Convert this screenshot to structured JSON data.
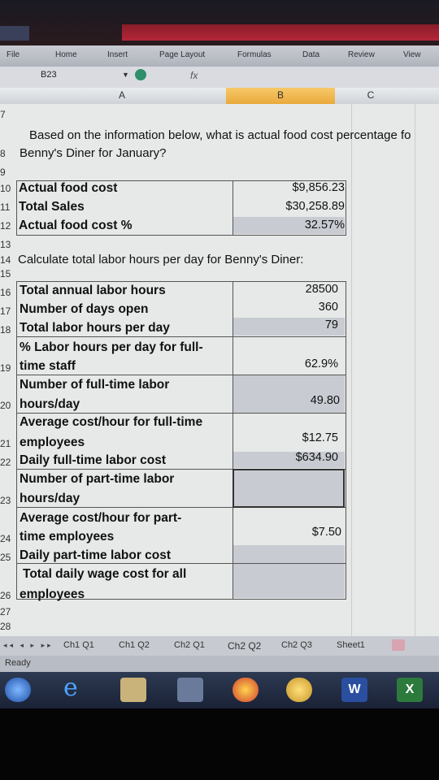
{
  "ribbon": {
    "tabs": [
      "File",
      "Home",
      "Insert",
      "Page Layout",
      "Formulas",
      "Data",
      "Review",
      "View"
    ]
  },
  "formula_bar": {
    "name_box": "B23",
    "fx": "fx",
    "value": ""
  },
  "columns": [
    "A",
    "B",
    "C"
  ],
  "rows": {
    "r7": "7",
    "r8": "8",
    "r9": "9",
    "r10": "10",
    "r11": "11",
    "r12": "12",
    "r13": "13",
    "r14": "14",
    "r15": "15",
    "r16": "16",
    "r17": "17",
    "r18": "18",
    "r19": "19",
    "r20": "20",
    "r21": "21",
    "r22": "22",
    "r23": "23",
    "r24": "24",
    "r25": "25",
    "r26": "26",
    "r27": "27",
    "r28": "28"
  },
  "sheet": {
    "question1_line1": "Based on the information below, what is actual food cost percentage fo",
    "question1_line2": "Benny's Diner for January?",
    "food": [
      {
        "label": "Actual food cost",
        "value": "$9,856.23"
      },
      {
        "label": "Total Sales",
        "value": "$30,258.89"
      },
      {
        "label": "Actual food cost %",
        "value": "32.57%"
      }
    ],
    "question2": "Calculate total labor hours per day for Benny's Diner:",
    "labor": {
      "annual_label": "Total annual labor hours",
      "annual_value": "28500",
      "days_label": "Number of days open",
      "days_value": "360",
      "perday_label": "Total labor hours per day",
      "perday_value": "79",
      "pct_ft_label1": "% Labor hours per day for full-",
      "pct_ft_label2": "time staff",
      "pct_ft_value": "62.9%",
      "ft_hours_label1": "Number of full-time labor",
      "ft_hours_label2": "hours/day",
      "ft_hours_value": "49.80",
      "ft_cost_label1": "Average cost/hour for full-time",
      "ft_cost_label2": "employees",
      "ft_cost_value": "$12.75",
      "daily_ft_label": "Daily full-time labor cost",
      "daily_ft_value": "$634.90",
      "pt_hours_label1": "Number of part-time labor",
      "pt_hours_label2": "hours/day",
      "pt_hours_value": "",
      "pt_cost_label1": "Average cost/hour for part-",
      "pt_cost_label2": "time employees",
      "pt_cost_value": "$7.50",
      "daily_pt_label": "Daily part-time labor cost",
      "daily_pt_value": "",
      "total_label1": "Total daily wage cost for all",
      "total_label2": "employees",
      "total_value": ""
    }
  },
  "sheet_tabs": [
    "Ch1 Q1",
    "Ch1 Q2",
    "Ch2 Q1",
    "Ch2 Q2",
    "Ch2 Q3",
    "Sheet1"
  ],
  "status": "Ready",
  "colors": {
    "selected_col": "#e9a93a",
    "shaded_cell": "#c8ccd2",
    "sheet_bg": "#e6e9e7"
  }
}
